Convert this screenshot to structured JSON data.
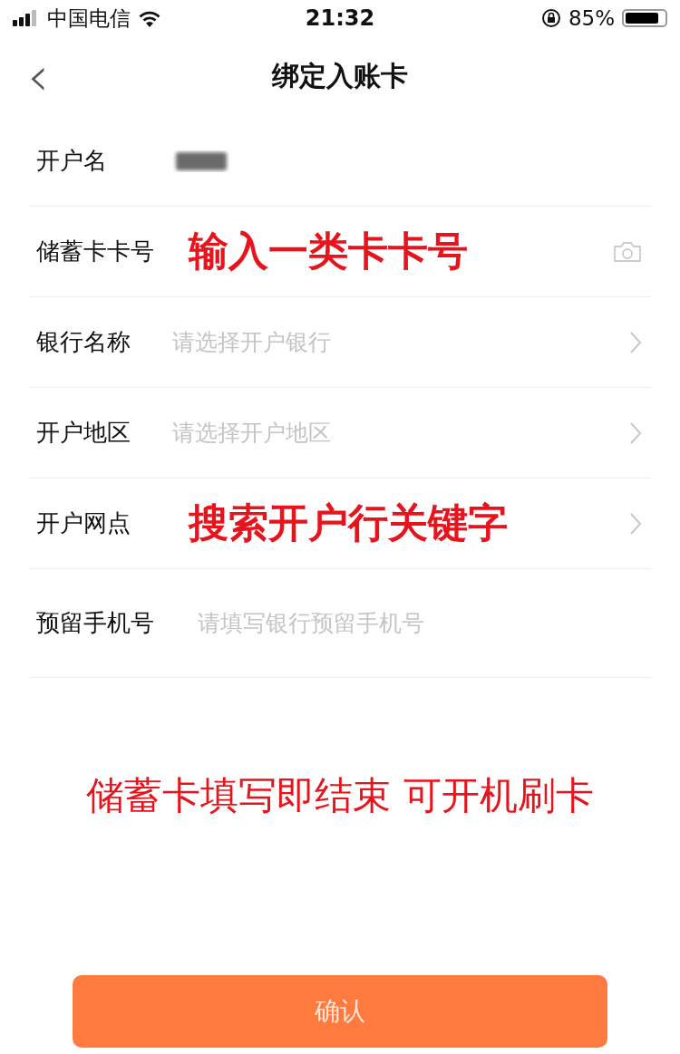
{
  "status_bar": {
    "carrier": "中国电信",
    "time": "21:32",
    "battery": "85%",
    "level": 0.85
  },
  "nav": {
    "back": "‹",
    "title": "绑定入账卡"
  },
  "rows": [
    {
      "label": "开户名",
      "redacted": true
    },
    {
      "label": "储蓄卡卡号",
      "note": "输入一类卡卡号",
      "camera": true
    },
    {
      "label": "银行名称",
      "placeholder": "请选择开户银行",
      "chevron": true
    },
    {
      "label": "开户地区",
      "placeholder": "请选择开户地区",
      "chevron": true
    },
    {
      "label": "开户网点",
      "note": "搜索开户行关键字",
      "chevron": true
    },
    {
      "label": "预留手机号",
      "placeholder": "请填写银行预留手机号"
    }
  ],
  "footer_note": "储蓄卡填写即结束 可开机刷卡",
  "confirm": "确认"
}
